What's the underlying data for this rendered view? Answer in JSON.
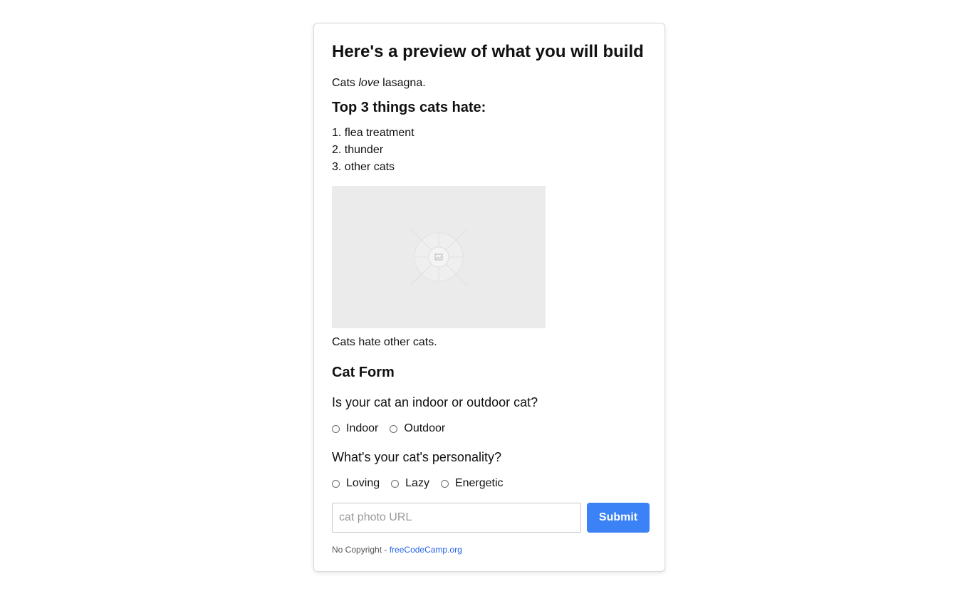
{
  "header": {
    "title": "Here's a preview of what you will build"
  },
  "intro": {
    "prefix": "Cats",
    "emphasis": "love",
    "suffix": "lasagna."
  },
  "hate_section": {
    "heading": "Top 3 things cats hate:",
    "items": [
      "1. flea treatment",
      "2. thunder",
      "3. other cats"
    ]
  },
  "figure": {
    "icon": "image-placeholder-icon",
    "caption": "Cats hate other cats."
  },
  "form": {
    "heading": "Cat Form",
    "question1": "Is your cat an indoor or outdoor cat?",
    "location_options": [
      "Indoor",
      "Outdoor"
    ],
    "question2": "What's your cat's personality?",
    "personality_options": [
      "Loving",
      "Lazy",
      "Energetic"
    ],
    "url_placeholder": "cat photo URL",
    "url_value": "",
    "submit_label": "Submit"
  },
  "footer": {
    "prefix": "No Copyright -",
    "link_text": "freeCodeCamp.org"
  },
  "colors": {
    "accent": "#3b82f6",
    "link": "#2563eb",
    "placeholder_bg": "#ebebeb"
  }
}
